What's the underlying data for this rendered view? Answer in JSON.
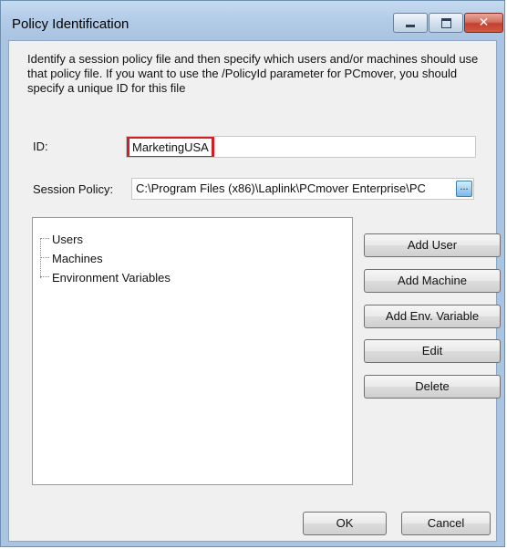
{
  "window": {
    "title": "Policy Identification",
    "controls": {
      "minimize_icon": "minimize-icon",
      "maximize_icon": "maximize-icon",
      "close_icon": "close-icon",
      "close_glyph": "✕"
    }
  },
  "description": "Identify a session policy file and then specify which users and/or machines should use that policy file. If you want to use the /PolicyId parameter for PCmover, you should specify a unique ID for this file",
  "fields": {
    "id_label": "ID:",
    "id_value": "MarketingUSA",
    "policy_label": "Session Policy:",
    "policy_value": "C:\\Program Files (x86)\\Laplink\\PCmover Enterprise\\PC",
    "browse_label": "..."
  },
  "tree": {
    "items": [
      "Users",
      "Machines",
      "Environment Variables"
    ]
  },
  "buttons": {
    "add_user": "Add User",
    "add_machine": "Add Machine",
    "add_env_variable": "Add Env. Variable",
    "edit": "Edit",
    "delete": "Delete",
    "ok": "OK",
    "cancel": "Cancel"
  },
  "colors": {
    "highlight": "#d21f26",
    "window_frame": "#a9c5e3"
  }
}
